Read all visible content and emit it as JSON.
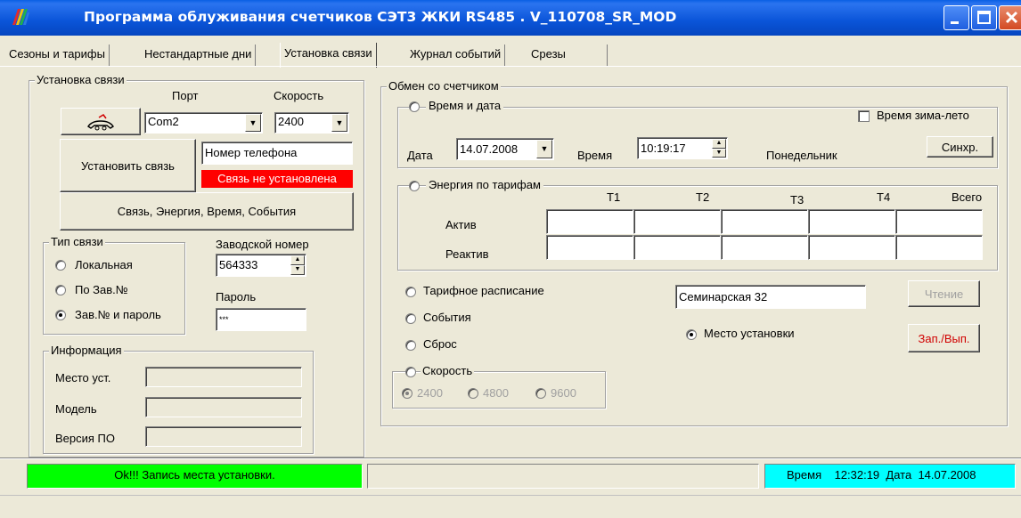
{
  "window": {
    "title": "Программа облуживания счетчиков СЭТ3   ЖКИ RS485 .  V_110708_SR_MOD"
  },
  "tabs": [
    {
      "label": "Сезоны и тарифы"
    },
    {
      "label": "Нестандартные дни"
    },
    {
      "label": "Установка связи"
    },
    {
      "label": "Журнал событий"
    },
    {
      "label": "Срезы"
    }
  ],
  "connection": {
    "group_label": "Установка связи",
    "port_label": "Порт",
    "speed_label": "Скорость",
    "port_value": "Com2",
    "speed_value": "2400",
    "connect_button": "Установить связь",
    "phone_value": "Номер телефона",
    "status_text": "Связь не установлена",
    "read_all_button": "Связь, Энергия, Время, События"
  },
  "link_type": {
    "group_label": "Тип связи",
    "options": [
      {
        "label": "Локальная",
        "selected": false
      },
      {
        "label": "По Зав.№",
        "selected": false
      },
      {
        "label": "Зав.№ и пароль",
        "selected": true
      }
    ]
  },
  "serial": {
    "label": "Заводской номер",
    "value": "564333",
    "password_label": "Пароль",
    "password_value": "***"
  },
  "info": {
    "group_label": "Информация",
    "fields": [
      {
        "label": "Место уст.",
        "value": ""
      },
      {
        "label": "Модель",
        "value": ""
      },
      {
        "label": "Версия ПО",
        "value": ""
      }
    ]
  },
  "exchange": {
    "group_label": "Обмен со счетчиком",
    "datetime": {
      "label": "Время и дата",
      "dst_label": "Время зима-лето",
      "date_label": "Дата",
      "date_value": "14.07.2008",
      "time_label": "Время",
      "time_value": "10:19:17",
      "weekday": "Понедельник",
      "sync_button": "Синхр."
    },
    "energy": {
      "label": "Энергия по тарифам",
      "columns": [
        "T1",
        "T2",
        "T3",
        "T4",
        "Всего"
      ],
      "rows": [
        {
          "label": "Актив",
          "values": [
            "",
            "",
            "",
            "",
            ""
          ]
        },
        {
          "label": "Реактив",
          "values": [
            "",
            "",
            "",
            "",
            ""
          ]
        }
      ]
    },
    "options": [
      {
        "label": "Тарифное расписание",
        "selected": false
      },
      {
        "label": "События",
        "selected": false
      },
      {
        "label": "Сброс",
        "selected": false
      }
    ],
    "speed": {
      "label": "Скорость",
      "options": [
        {
          "label": "2400",
          "selected": true
        },
        {
          "label": "4800",
          "selected": false
        },
        {
          "label": "9600",
          "selected": false
        }
      ]
    },
    "location_value": "Семинарская 32",
    "location_option": "Место установки",
    "read_button": "Чтение",
    "write_button": "Зап./Вып."
  },
  "statusbar": {
    "message": "Ok!!! Запись места установки.",
    "time_label": "Время",
    "time_value": "12:32:19",
    "date_label": "Дата",
    "date_value": "14.07.2008"
  },
  "colors": {
    "status_ok": "#00ff00",
    "status_error": "#ff0000",
    "clock_panel": "#00ffff"
  }
}
